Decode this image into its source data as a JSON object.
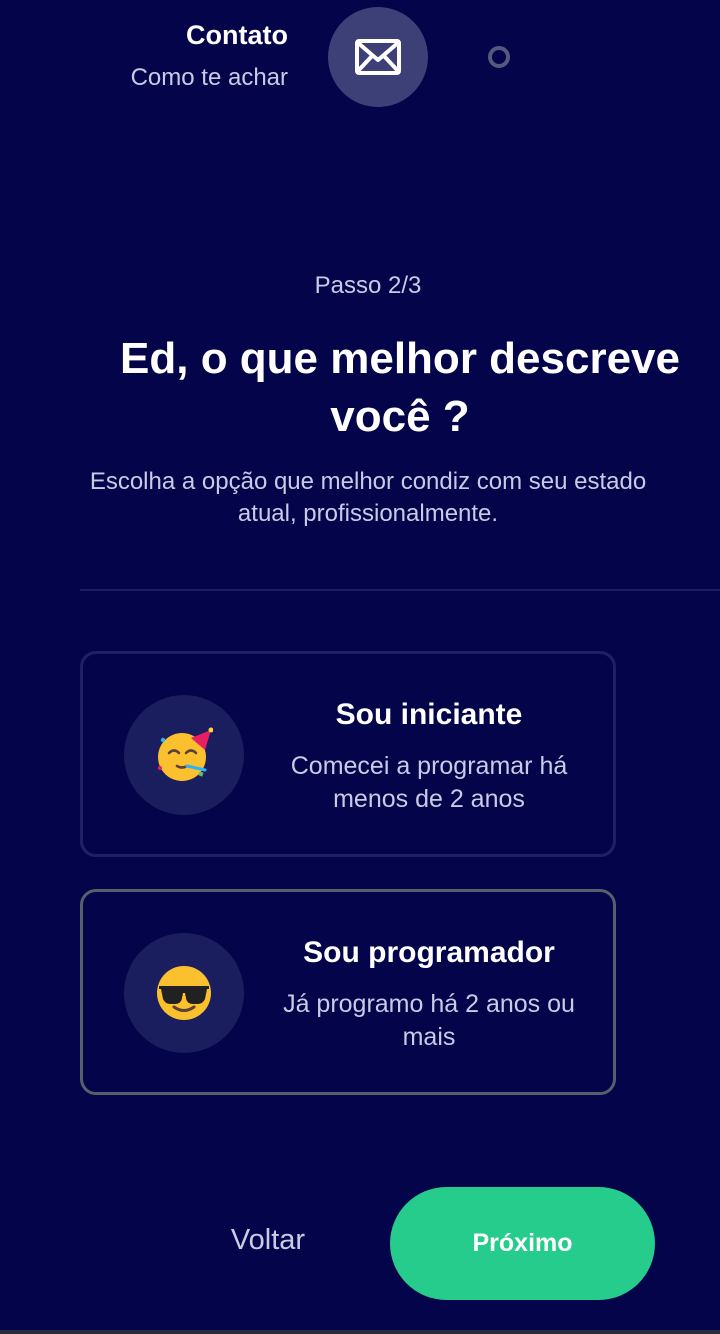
{
  "stepper": {
    "title": "Contato",
    "subtitle": "Como te achar",
    "icon": "envelope-icon"
  },
  "step_label": "Passo 2/3",
  "heading": "Ed, o que melhor descreve você ?",
  "description": "Escolha a opção que melhor condiz com seu estado atual, profissionalmente.",
  "options": [
    {
      "title": "Sou iniciante",
      "text": "Comecei a programar há menos de 2 anos",
      "icon": "partying-face-emoji",
      "selected": false
    },
    {
      "title": "Sou programador",
      "text": "Já programo há 2 anos ou mais",
      "icon": "sunglasses-face-emoji",
      "selected": true
    }
  ],
  "buttons": {
    "back": "Voltar",
    "next": "Próximo"
  },
  "colors": {
    "background": "#03044a",
    "accent": "#26cc8b",
    "card_border": "#1e2265",
    "selected_border": "#56606a"
  }
}
